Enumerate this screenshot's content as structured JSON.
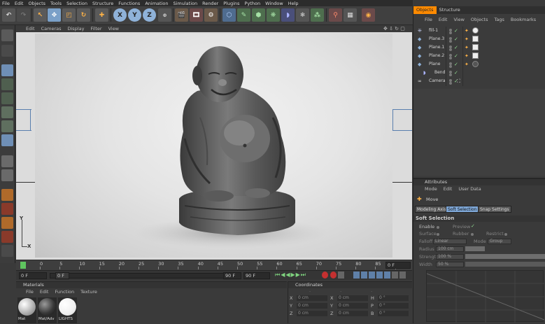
{
  "menubar": [
    "File",
    "Edit",
    "Objects",
    "Tools",
    "Selection",
    "Structure",
    "Functions",
    "Animation",
    "Simulation",
    "Render",
    "Plugins",
    "Python",
    "Window",
    "Help"
  ],
  "viewport_menu": [
    "Edit",
    "Cameras",
    "Display",
    "Filter",
    "View"
  ],
  "axis_labels": {
    "y": "Y",
    "x": "X"
  },
  "toolbar_axes": [
    "X",
    "Y",
    "Z"
  ],
  "timeline": {
    "ticks": [
      "0",
      "5",
      "10",
      "15",
      "20",
      "25",
      "30",
      "35",
      "40",
      "45",
      "50",
      "55",
      "60",
      "65",
      "70",
      "75",
      "80",
      "85",
      "90"
    ],
    "end_frame": "0 F"
  },
  "controls": {
    "start": "0 F",
    "current": "0 F",
    "end": "90 F",
    "max": "90 F"
  },
  "materials": {
    "title": "Materials",
    "menu": [
      "File",
      "Edit",
      "Function",
      "Texture"
    ],
    "items": [
      {
        "label": "Mat"
      },
      {
        "label": "Mat/Adv"
      },
      {
        "label": "LIGHTS"
      }
    ]
  },
  "coordinates": {
    "title": "Coordinates",
    "rows": [
      {
        "axis": "X",
        "v1": "0 cm",
        "a2": "X",
        "v2": "0 cm",
        "a3": "H",
        "v3": "0 °"
      },
      {
        "axis": "Y",
        "v1": "0 cm",
        "a2": "Y",
        "v2": "0 cm",
        "a3": "P",
        "v3": "0 °"
      },
      {
        "axis": "Z",
        "v1": "0 cm",
        "a2": "Z",
        "v2": "0 cm",
        "a3": "B",
        "v3": "0 °"
      }
    ]
  },
  "objects_panel": {
    "tabs": [
      "Objects",
      "Structure"
    ],
    "menu": [
      "File",
      "Edit",
      "View",
      "Objects",
      "Tags",
      "Bookmarks"
    ],
    "items": [
      {
        "name": "fill-1"
      },
      {
        "name": "Plane.3"
      },
      {
        "name": "Plane.1"
      },
      {
        "name": "Plane.2"
      },
      {
        "name": "Plane"
      },
      {
        "name": "Bend"
      },
      {
        "name": "Camera"
      }
    ]
  },
  "attributes": {
    "title": "Attributes",
    "menu": [
      "Mode",
      "Edit",
      "User Data"
    ],
    "tool": "Move",
    "tabs": [
      "Modeling Axis",
      "Soft Selection",
      "Snap Settings"
    ],
    "section": "Soft Selection",
    "enable": "Enable",
    "preview": "Preview",
    "surface": "Surface",
    "rubber": "Rubber",
    "restrict": "Restrict",
    "falloff_label": "Falloff",
    "falloff_value": "Linear",
    "mode_label": "Mode",
    "mode_value": "Group",
    "radius_label": "Radius",
    "radius_value": "100 cm",
    "strength_label": "Strength",
    "strength_value": "100 %",
    "width_label": "Width",
    "width_value": "50 %"
  }
}
